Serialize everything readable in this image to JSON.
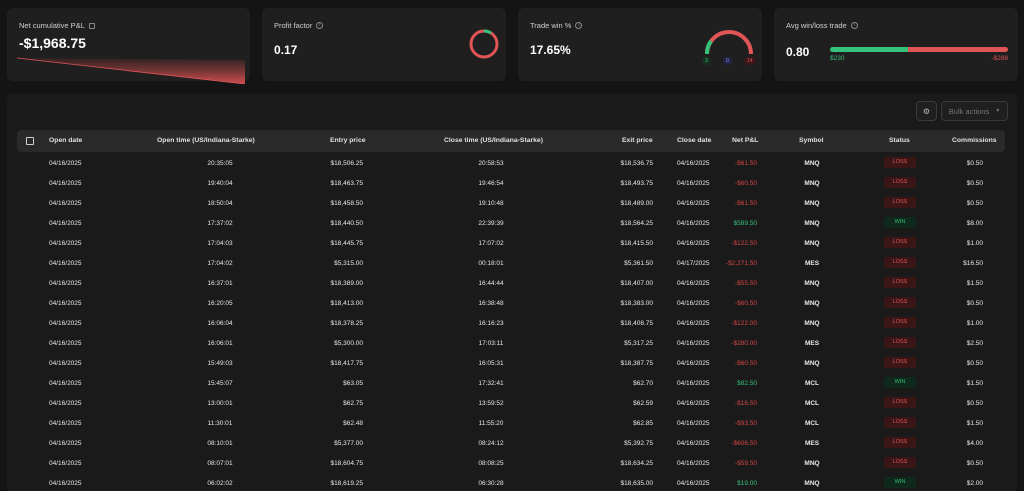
{
  "stats": {
    "net_pnl": {
      "label": "Net cumulative P&L",
      "value": "-$1,968.75"
    },
    "profit_factor": {
      "label": "Profit factor",
      "value": "0.17"
    },
    "win_rate": {
      "label": "Trade win %",
      "value": "17.65%",
      "wins": "3",
      "breakeven": "0",
      "losses": "14"
    },
    "avg_win_loss": {
      "label": "Avg win/loss trade",
      "value": "0.80",
      "avg_win": "$230",
      "avg_loss": "-$288"
    }
  },
  "colors": {
    "win": "#35c27a",
    "loss": "#e05555",
    "card": "#1f1f1f",
    "bg": "#141414"
  },
  "toolbar": {
    "bulk_actions": "Bulk actions"
  },
  "table": {
    "headers": {
      "open_date": "Open date",
      "open_time": "Open time (US/Indiana-Starke)",
      "entry_price": "Entry price",
      "close_time": "Close time (US/Indiana-Starke)",
      "exit_price": "Exit price",
      "close_date": "Close date",
      "net_pnl": "Net P&L",
      "symbol": "Symbol",
      "status": "Status",
      "commissions": "Commissions"
    },
    "rows": [
      {
        "open_date": "04/16/2025",
        "open_time": "20:35:05",
        "entry": "$18,506.25",
        "close_time": "20:58:53",
        "exit": "$18,536.75",
        "close_date": "04/16/2025",
        "pnl": "-$61.50",
        "symbol": "MNQ",
        "status": "LOSS",
        "comm": "$0.50"
      },
      {
        "open_date": "04/16/2025",
        "open_time": "19:40:04",
        "entry": "$18,463.75",
        "close_time": "19:46:54",
        "exit": "$18,493.75",
        "close_date": "04/16/2025",
        "pnl": "-$60.50",
        "symbol": "MNQ",
        "status": "LOSS",
        "comm": "$0.50"
      },
      {
        "open_date": "04/16/2025",
        "open_time": "18:50:04",
        "entry": "$18,458.50",
        "close_time": "19:10:48",
        "exit": "$18,489.00",
        "close_date": "04/16/2025",
        "pnl": "-$61.50",
        "symbol": "MNQ",
        "status": "LOSS",
        "comm": "$0.50"
      },
      {
        "open_date": "04/16/2025",
        "open_time": "17:37:02",
        "entry": "$18,440.50",
        "close_time": "22:39:39",
        "exit": "$18,564.25",
        "close_date": "04/16/2025",
        "pnl": "$589.50",
        "symbol": "MNQ",
        "status": "WIN",
        "comm": "$8.00"
      },
      {
        "open_date": "04/16/2025",
        "open_time": "17:04:03",
        "entry": "$18,445.75",
        "close_time": "17:07:02",
        "exit": "$18,415.50",
        "close_date": "04/16/2025",
        "pnl": "-$122.50",
        "symbol": "MNQ",
        "status": "LOSS",
        "comm": "$1.00"
      },
      {
        "open_date": "04/16/2025",
        "open_time": "17:04:02",
        "entry": "$5,315.00",
        "close_time": "00:18:01",
        "exit": "$5,361.50",
        "close_date": "04/17/2025",
        "pnl": "-$2,271.50",
        "symbol": "MES",
        "status": "LOSS",
        "comm": "$16.50"
      },
      {
        "open_date": "04/16/2025",
        "open_time": "16:37:01",
        "entry": "$18,389.00",
        "close_time": "16:44:44",
        "exit": "$18,407.00",
        "close_date": "04/16/2025",
        "pnl": "-$55.50",
        "symbol": "MNQ",
        "status": "LOSS",
        "comm": "$1.50"
      },
      {
        "open_date": "04/16/2025",
        "open_time": "16:20:05",
        "entry": "$18,413.00",
        "close_time": "16:38:48",
        "exit": "$18,383.00",
        "close_date": "04/16/2025",
        "pnl": "-$60.50",
        "symbol": "MNQ",
        "status": "LOSS",
        "comm": "$0.50"
      },
      {
        "open_date": "04/16/2025",
        "open_time": "16:06:04",
        "entry": "$18,378.25",
        "close_time": "16:16:23",
        "exit": "$18,408.75",
        "close_date": "04/16/2025",
        "pnl": "-$122.00",
        "symbol": "MNQ",
        "status": "LOSS",
        "comm": "$1.00"
      },
      {
        "open_date": "04/16/2025",
        "open_time": "16:06:01",
        "entry": "$5,300.00",
        "close_time": "17:03:11",
        "exit": "$5,317.25",
        "close_date": "04/16/2025",
        "pnl": "-$280.00",
        "symbol": "MES",
        "status": "LOSS",
        "comm": "$2.50"
      },
      {
        "open_date": "04/16/2025",
        "open_time": "15:49:03",
        "entry": "$18,417.75",
        "close_time": "16:05:31",
        "exit": "$18,387.75",
        "close_date": "04/16/2025",
        "pnl": "-$60.50",
        "symbol": "MNQ",
        "status": "LOSS",
        "comm": "$0.50"
      },
      {
        "open_date": "04/16/2025",
        "open_time": "15:45:07",
        "entry": "$63.05",
        "close_time": "17:32:41",
        "exit": "$62.70",
        "close_date": "04/16/2025",
        "pnl": "$82.50",
        "symbol": "MCL",
        "status": "WIN",
        "comm": "$1.50"
      },
      {
        "open_date": "04/16/2025",
        "open_time": "13:00:01",
        "entry": "$62.75",
        "close_time": "13:59:52",
        "exit": "$62.59",
        "close_date": "04/16/2025",
        "pnl": "-$16.50",
        "symbol": "MCL",
        "status": "LOSS",
        "comm": "$0.50"
      },
      {
        "open_date": "04/16/2025",
        "open_time": "11:30:01",
        "entry": "$62.48",
        "close_time": "11:55:20",
        "exit": "$62.85",
        "close_date": "04/16/2025",
        "pnl": "-$93.50",
        "symbol": "MCL",
        "status": "LOSS",
        "comm": "$1.50"
      },
      {
        "open_date": "04/16/2025",
        "open_time": "08:10:01",
        "entry": "$5,377.00",
        "close_time": "08:24:12",
        "exit": "$5,392.75",
        "close_date": "04/16/2025",
        "pnl": "-$606.50",
        "symbol": "MES",
        "status": "LOSS",
        "comm": "$4.00"
      },
      {
        "open_date": "04/16/2025",
        "open_time": "08:07:01",
        "entry": "$18,604.75",
        "close_time": "08:08:25",
        "exit": "$18,634.25",
        "close_date": "04/16/2025",
        "pnl": "-$59.50",
        "symbol": "MNQ",
        "status": "LOSS",
        "comm": "$0.50"
      },
      {
        "open_date": "04/16/2025",
        "open_time": "06:02:02",
        "entry": "$18,619.25",
        "close_time": "06:30:28",
        "exit": "$18,635.00",
        "close_date": "04/16/2025",
        "pnl": "$19.00",
        "symbol": "MNQ",
        "status": "WIN",
        "comm": "$2.00"
      }
    ]
  }
}
